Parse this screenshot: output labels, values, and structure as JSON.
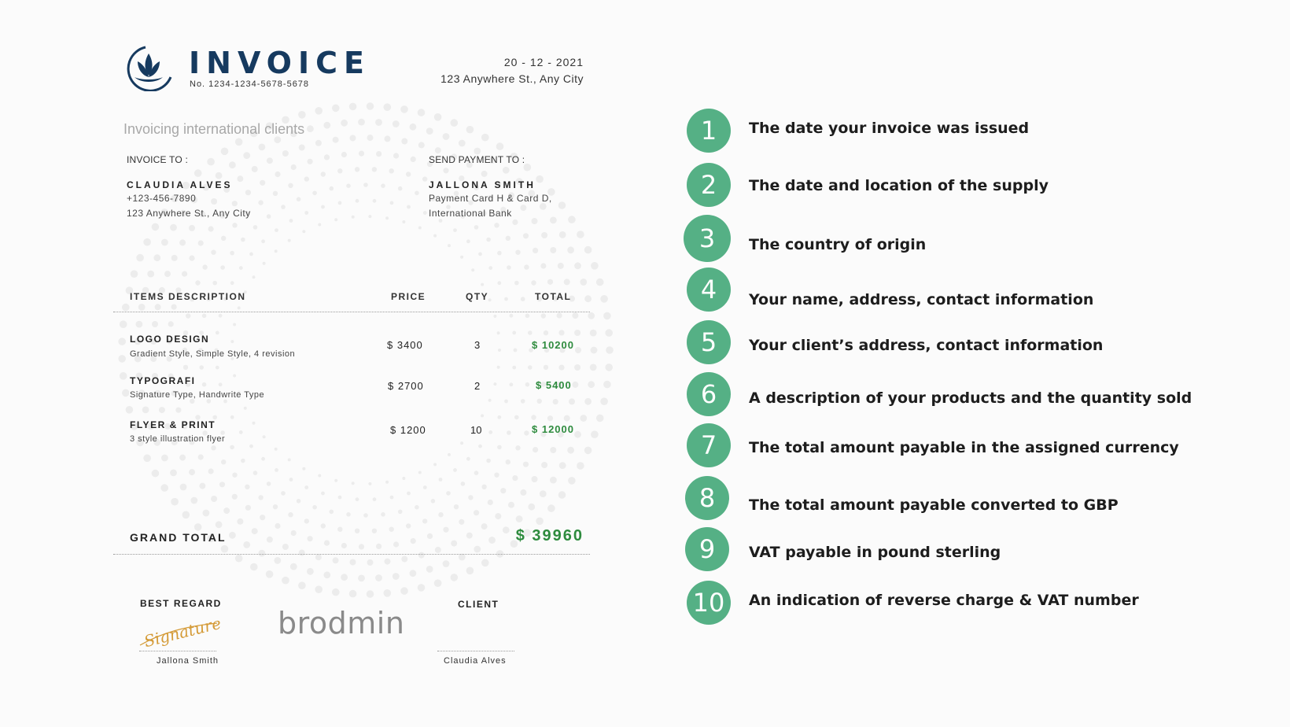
{
  "header": {
    "title": "INVOICE",
    "number": "No. 1234-1234-5678-5678",
    "date": "20 - 12 - 2021",
    "address": "123 Anywhere St., Any City",
    "subtitle": "Invoicing international clients"
  },
  "invoice_to": {
    "label": "INVOICE TO :",
    "name": "CLAUDIA ALVES",
    "phone": "+123-456-7890",
    "address": "123 Anywhere St., Any City"
  },
  "send_payment": {
    "label": "SEND PAYMENT TO :",
    "name": "JALLONA SMITH",
    "line1": "Payment Card H & Card D,",
    "line2": "International Bank"
  },
  "table": {
    "headers": [
      "ITEMS DESCRIPTION",
      "PRICE",
      "QTY",
      "TOTAL"
    ],
    "rows": [
      {
        "name": "LOGO DESIGN",
        "desc": "Gradient Style, Simple Style, 4 revision",
        "price": "$ 3400",
        "qty": "3",
        "total": "$ 10200"
      },
      {
        "name": "TYPOGRAFI",
        "desc": "Signature Type, Handwrite Type",
        "price": "$ 2700",
        "qty": "2",
        "total": "$ 5400"
      },
      {
        "name": "FLYER & PRINT",
        "desc": "3 style illustration flyer",
        "price": "$ 1200",
        "qty": "10",
        "total": "$ 12000"
      }
    ]
  },
  "grand_total": {
    "label": "GRAND TOTAL",
    "value": "$ 39960"
  },
  "footer": {
    "best_regard": "BEST REGARD",
    "signature_text": "Signature",
    "sender_name": "Jallona Smith",
    "brand": "brodmin",
    "client_label": "CLIENT",
    "client_name": "Claudia Alves"
  },
  "notes": [
    {
      "num": "1",
      "text": "The date your invoice was issued"
    },
    {
      "num": "2",
      "text": "The date and location of the supply"
    },
    {
      "num": "3",
      "text": "The country of origin"
    },
    {
      "num": "4",
      "text": "Your name, address, contact information"
    },
    {
      "num": "5",
      "text": "Your client’s address, contact information"
    },
    {
      "num": "6",
      "text": "A description of your products and the quantity sold"
    },
    {
      "num": "7",
      "text": "The total amount payable in the assigned currency"
    },
    {
      "num": "8",
      "text": "The total amount payable converted to GBP"
    },
    {
      "num": "9",
      "text": "VAT payable in pound sterling"
    },
    {
      "num": "10",
      "text": "An indication of reverse charge & VAT number"
    }
  ],
  "colors": {
    "accent_green": "#55b085",
    "total_green": "#2e8b3e",
    "title_navy": "#163a5f"
  }
}
